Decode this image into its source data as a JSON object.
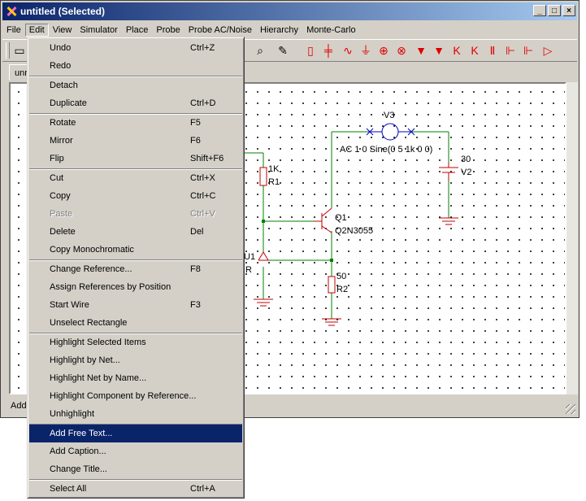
{
  "window": {
    "title": "untitled (Selected)",
    "minimize": "_",
    "maximize": "□",
    "close": "×"
  },
  "menubar": [
    "File",
    "Edit",
    "View",
    "Simulator",
    "Place",
    "Probe",
    "Probe AC/Noise",
    "Hierarchy",
    "Monte-Carlo"
  ],
  "toolbar": {
    "icons": [
      "open-icon",
      "zoom-icon",
      "pencil-icon",
      "resistor-icon",
      "capacitor-icon",
      "inductor-icon",
      "ground-icon",
      "voltage-source-icon",
      "current-source-icon",
      "diode-icon",
      "zener-icon",
      "transistor-icon",
      "transistor-icon",
      "jfet-icon",
      "mosfet-icon",
      "mosfet-icon",
      "opamp-icon"
    ]
  },
  "tab": {
    "label": "unn"
  },
  "status": {
    "text": "Add"
  },
  "schematic": {
    "v3_name": "V3",
    "v3_value": "AC 1 0 Sine(0 5 1k 0 0)",
    "v2_value": "30",
    "v2_name": "V2",
    "r1_value": "1K",
    "r1_name": "R1",
    "q1_name": "Q1",
    "q1_model": "Q2N3055",
    "u1_name": "U1",
    "u1_partial": "R",
    "r2_value": "50",
    "r2_name": "R2"
  },
  "edit_menu": {
    "items": [
      {
        "label": "Undo",
        "accel": "Ctrl+Z"
      },
      {
        "label": "Redo",
        "accel": ""
      },
      {
        "label": "Detach",
        "accel": ""
      },
      {
        "label": "Duplicate",
        "accel": "Ctrl+D"
      },
      {
        "label": "Rotate",
        "accel": "F5"
      },
      {
        "label": "Mirror",
        "accel": "F6"
      },
      {
        "label": "Flip",
        "accel": "Shift+F6"
      },
      {
        "label": "Cut",
        "accel": "Ctrl+X"
      },
      {
        "label": "Copy",
        "accel": "Ctrl+C"
      },
      {
        "label": "Paste",
        "accel": "Ctrl+V"
      },
      {
        "label": "Delete",
        "accel": "Del"
      },
      {
        "label": "Copy Monochromatic",
        "accel": ""
      },
      {
        "label": "Change Reference...",
        "accel": "F8"
      },
      {
        "label": "Assign References by Position",
        "accel": ""
      },
      {
        "label": "Start Wire",
        "accel": "F3"
      },
      {
        "label": "Unselect Rectangle",
        "accel": ""
      },
      {
        "label": "Highlight Selected Items",
        "accel": ""
      },
      {
        "label": "Highlight by Net...",
        "accel": ""
      },
      {
        "label": "Highlight Net by Name...",
        "accel": ""
      },
      {
        "label": "Highlight Component by Reference...",
        "accel": ""
      },
      {
        "label": "Unhighlight",
        "accel": ""
      },
      {
        "label": "Add Free Text...",
        "accel": ""
      },
      {
        "label": "Add Caption...",
        "accel": ""
      },
      {
        "label": "Change Title...",
        "accel": ""
      },
      {
        "label": "Select All",
        "accel": "Ctrl+A"
      }
    ]
  }
}
